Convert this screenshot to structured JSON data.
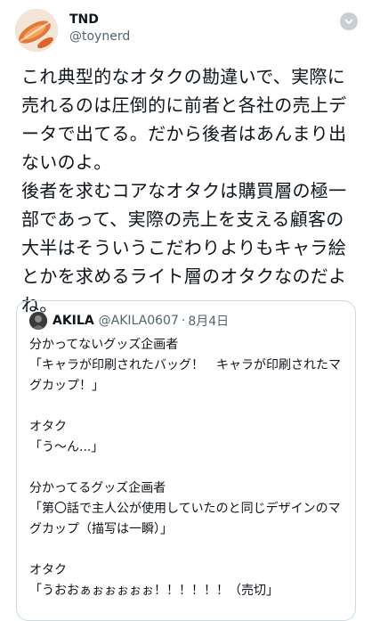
{
  "author": {
    "display_name": "TND",
    "handle": "@toynerd"
  },
  "tweet": {
    "text": "これ典型的なオタクの勘違いで、実際に売れるのは圧倒的に前者と各社の売上データで出てる。だから後者はあんまり出ないのよ。\n後者を求むコアなオタクは購買層の極一部であって、実際の売上を支える顧客の大半はそういうこだわりよりもキャラ絵とかを求めるライト層のオタクなのだよね。"
  },
  "quote": {
    "display_name": "AKILA",
    "handle": "@AKILA0607",
    "separator": "·",
    "date": "8月4日",
    "text": "分かってないグッズ企画者\n「キャラが印刷されたバッグ！　キャラが印刷されたマグカップ！」\n\nオタク\n「う〜ん...」\n\n分かってるグッズ企画者\n「第〇話で主人公が使用していたのと同じデザインのマグカップ（描写は一瞬）」\n\nオタク\n「うおおぁぉぉぉぉぉ！！！！！！（売切」\n\n誰か分かって。"
  },
  "icons": {
    "more": "chevron-down-icon"
  },
  "colors": {
    "text": "#0f1419",
    "secondary": "#536471",
    "border": "#cfd9de",
    "more_button": "#c9cfd3"
  }
}
